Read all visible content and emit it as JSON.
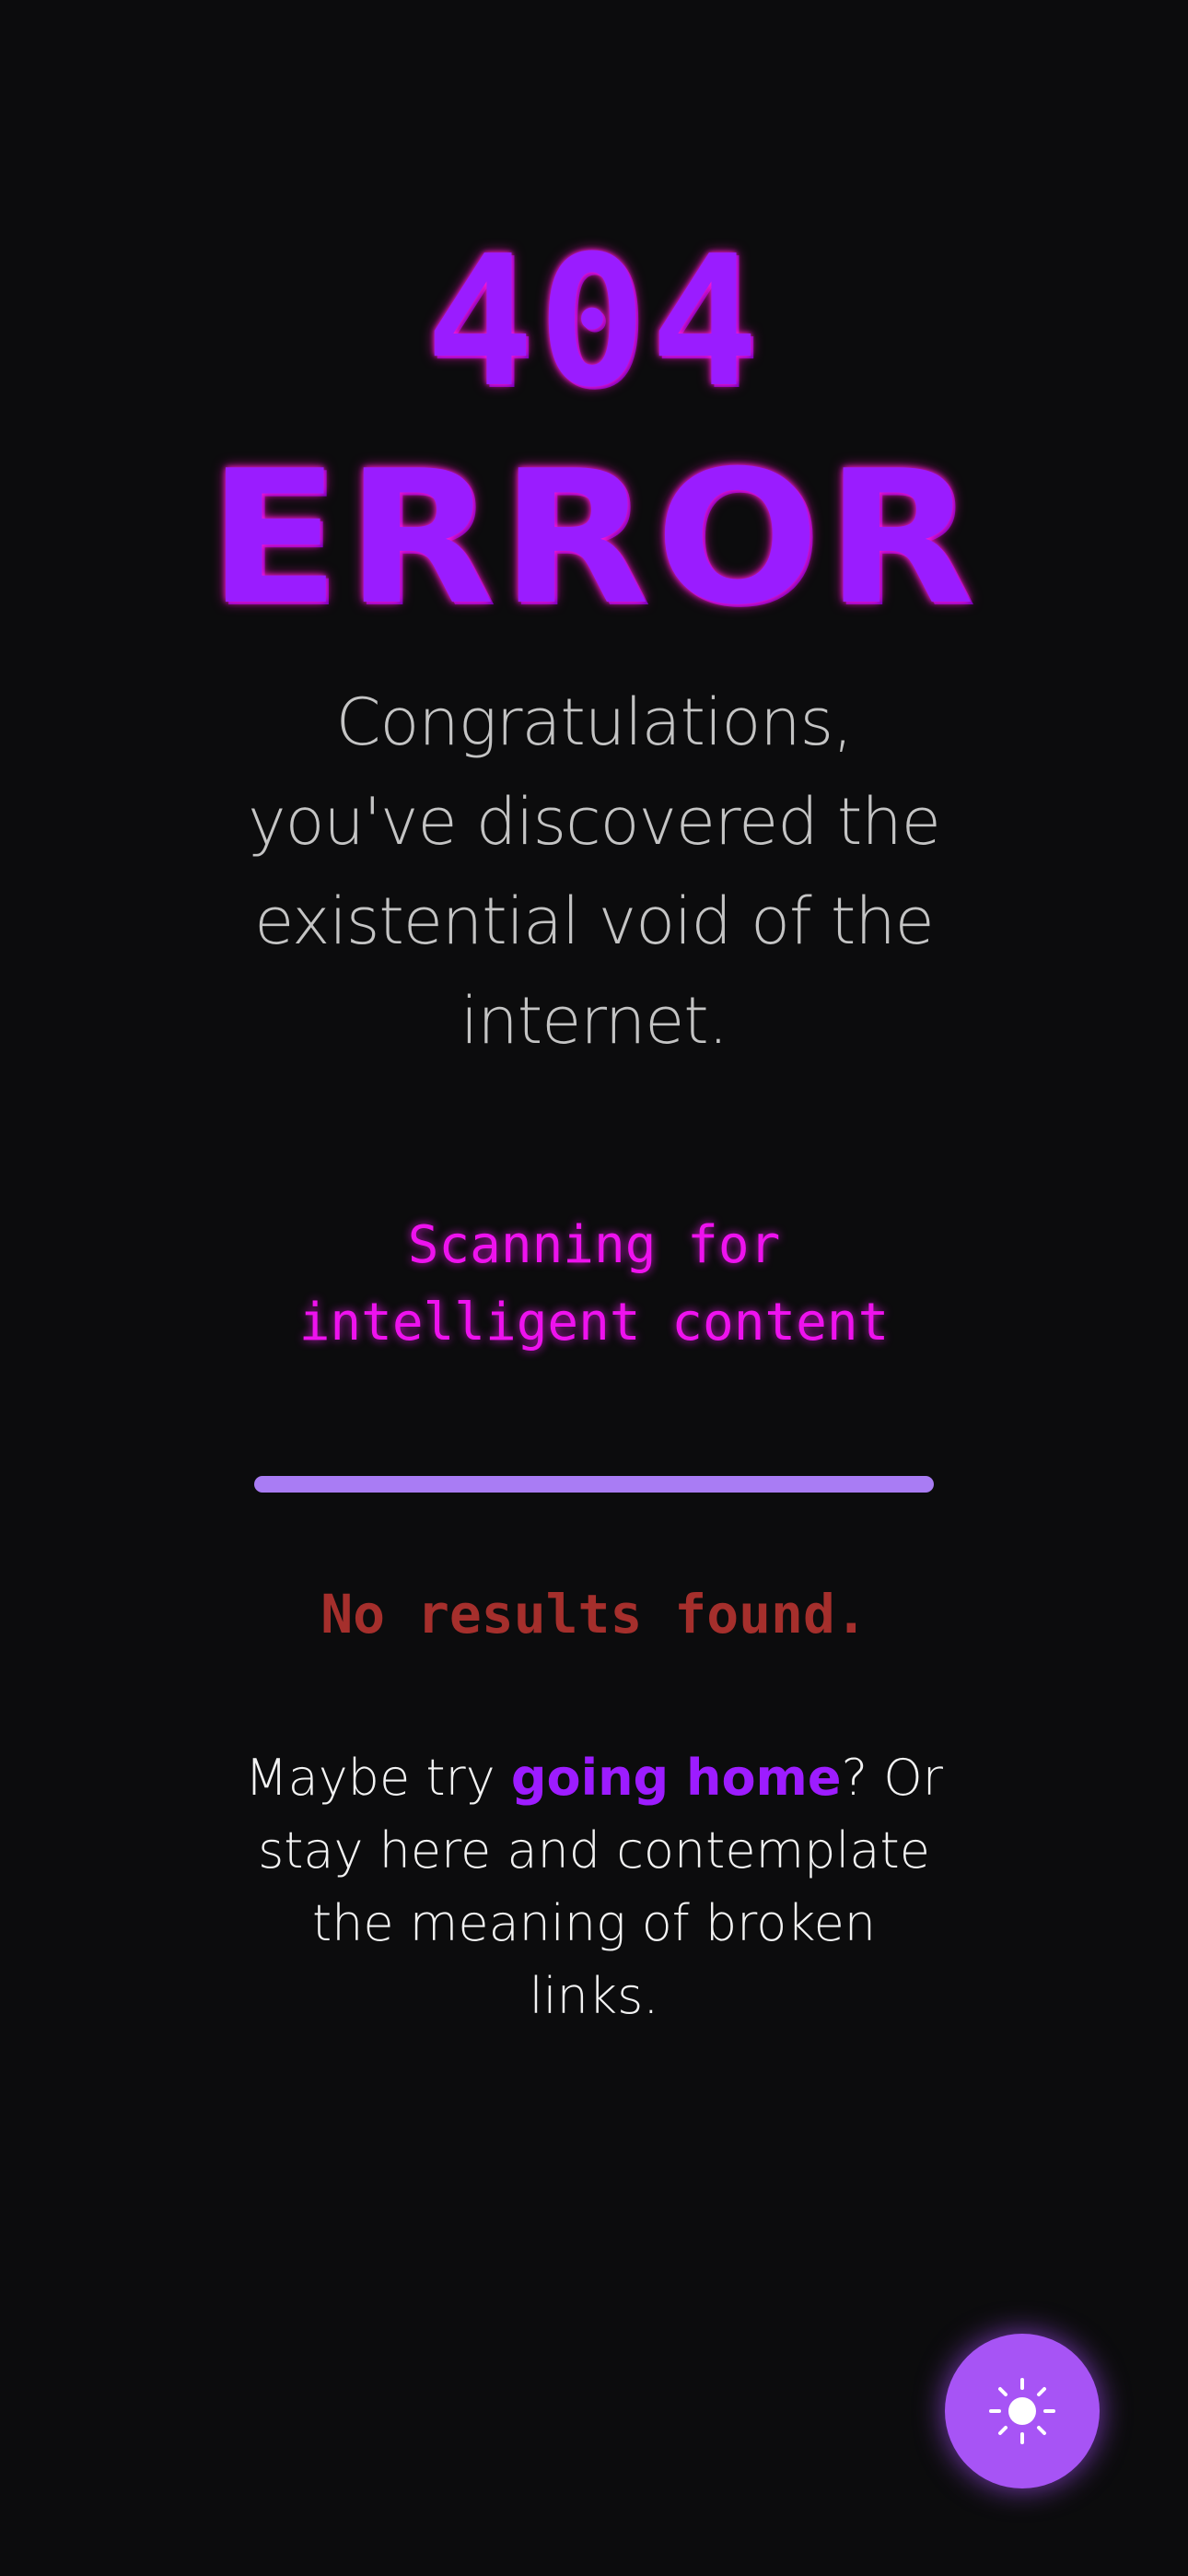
{
  "error": {
    "code": "404",
    "label": "ERROR"
  },
  "headline": "Congratulations, you've discovered the existential void of the internet.",
  "scanning": {
    "text": "Scanning for intelligent content",
    "progress": 1.0
  },
  "result": {
    "message": "No results found."
  },
  "suggestion": {
    "prefix": "Maybe try ",
    "link_label": "going home",
    "suffix": "? Or stay here and contemplate the meaning of broken links."
  },
  "theme_toggle": {
    "icon": "sun-icon"
  },
  "colors": {
    "background": "#0c0c0d",
    "accent": "#9a1cff",
    "glow": "#ff1adb",
    "scanning": "#ee12ee",
    "progress": "#a97cf4",
    "error_text": "#a52f2c",
    "button": "#a754f5"
  }
}
